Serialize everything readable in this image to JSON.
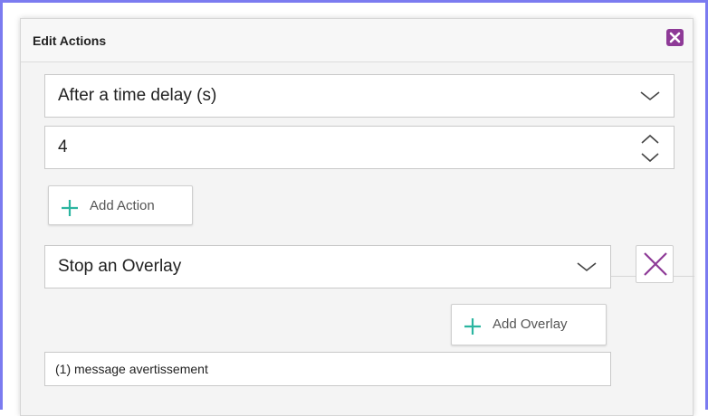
{
  "dialog": {
    "title": "Edit Actions",
    "close_icon": "close-x-icon",
    "accent_color": "#8e3a97",
    "plus_color": "#2bb5a0"
  },
  "trigger": {
    "selected": "After a time delay (s)",
    "delay_value": "4"
  },
  "add_action": {
    "label": "Add Action",
    "icon": "plus-icon"
  },
  "action": {
    "selected": "Stop an Overlay",
    "delete_icon": "x-icon"
  },
  "add_overlay": {
    "label": "Add Overlay",
    "icon": "plus-icon"
  },
  "overlay_list": {
    "value": "(1) message avertissement"
  }
}
